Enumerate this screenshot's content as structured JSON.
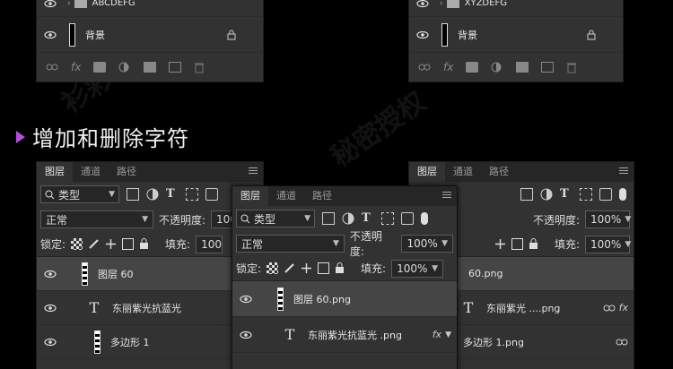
{
  "title": "增加和删除字符",
  "watermarks": [
    "衫彩演示",
    "秘密授权"
  ],
  "top_left_panel": {
    "layers": [
      {
        "name": "ABCDEFG",
        "type": "group"
      },
      {
        "name": "背景",
        "type": "background"
      }
    ]
  },
  "top_right_panel": {
    "layers": [
      {
        "name": "XYZDEFG",
        "type": "group"
      },
      {
        "name": "背景",
        "type": "background"
      }
    ]
  },
  "panel_left": {
    "tabs": [
      "图层",
      "通道",
      "路径"
    ],
    "filter": "类型",
    "blend": "正常",
    "opacity_label": "不透明度:",
    "opacity": "100",
    "lock_label": "锁定:",
    "fill_label": "填充:",
    "fill": "100",
    "layers": [
      {
        "name": "图层 60",
        "type": "dashed",
        "selected": true
      },
      {
        "name": "东丽紫光抗蓝光",
        "type": "text",
        "badge": "fx"
      },
      {
        "name": "多边形 1",
        "type": "shape"
      }
    ]
  },
  "panel_middle": {
    "tabs": [
      "图层",
      "通道",
      "路径"
    ],
    "filter": "类型",
    "blend": "正常",
    "opacity_label": "不透明度:",
    "opacity": "100%",
    "lock_label": "锁定:",
    "fill_label": "填充:",
    "fill": "100%",
    "layers": [
      {
        "name": "图层 60.png",
        "type": "dashed",
        "selected": true
      },
      {
        "name": "东丽紫光抗蓝光 .png",
        "type": "text",
        "badge": "fx"
      }
    ]
  },
  "panel_right": {
    "tabs": [
      "图层",
      "通道",
      "路径"
    ],
    "opacity_label": "不透明度:",
    "opacity": "100%",
    "fill_label": "填充:",
    "fill": "100%",
    "layers": [
      {
        "name": "60.png",
        "type": "dashed",
        "selected": true
      },
      {
        "name": "东丽紫光 ....png",
        "type": "text",
        "badge": "fx"
      },
      {
        "name": "多边形 1.png",
        "type": "shape"
      }
    ]
  },
  "colors": {
    "accent": "#b44ed6",
    "panel": "#323232",
    "tabbar": "#262626",
    "selected": "#454545"
  }
}
